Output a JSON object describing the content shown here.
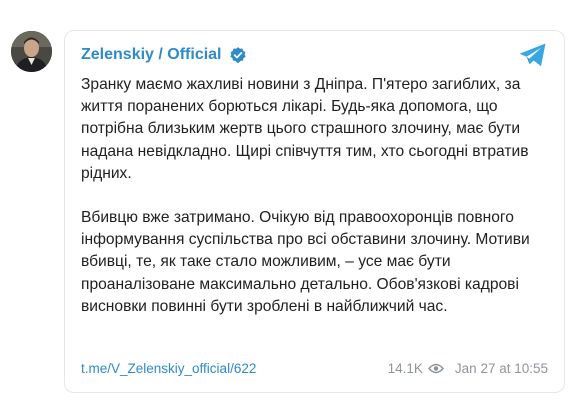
{
  "channel": {
    "name": "Zelenskiy / Official",
    "avatar_icon": "avatar",
    "verified_icon": "verified-badge-icon",
    "app_icon": "telegram-icon",
    "accent_color": "#2e8bc9"
  },
  "message": {
    "paragraph_1": "Зранку маємо жахливі новини з Дніпра. П'ятеро загиблих, за життя поранених борються лікарі. Будь-яка допомога, що потрібна близьким жертв цього страшного злочину, має бути надана невідкладно. Щирі співчуття тим, хто сьогодні втратив рідних.",
    "paragraph_2": "Вбивцю вже затримано. Очікую від правоохоронців повного інформування суспільства про всі обставини злочину. Мотиви вбивці, те, як таке стало можливим, – усе має бути проаналізоване максимально детально. Обов'язкові кадрові висновки повинні бути зроблені в найближчий час."
  },
  "footer": {
    "link": "t.me/V_Zelenskiy_official/622",
    "views": "14.1K",
    "views_icon": "eye-icon",
    "date": "Jan 27 at 10:55"
  }
}
